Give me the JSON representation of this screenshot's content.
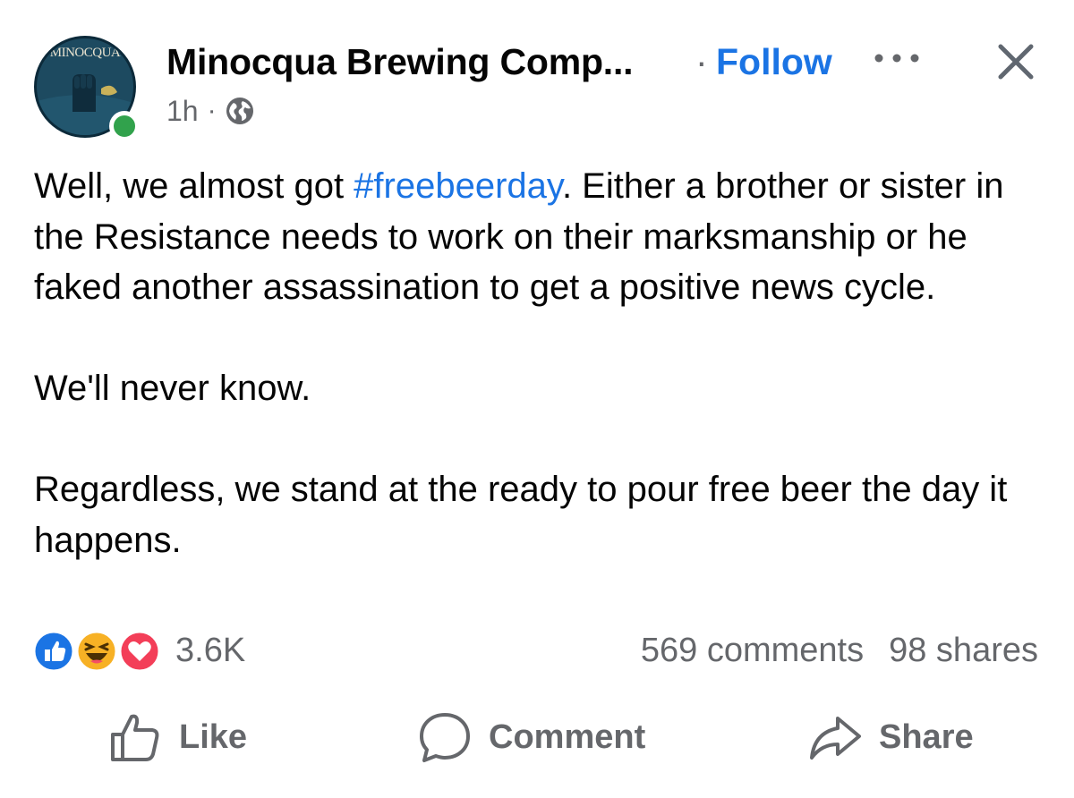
{
  "header": {
    "avatar_text": "MINOCQUA",
    "page_name": "Minocqua Brewing Comp...",
    "separator": "·",
    "follow_label": "Follow",
    "time": "1h",
    "time_separator": "·",
    "audience_icon": "globe-icon",
    "more_icon": "more-horizontal-icon",
    "close_icon": "close-icon"
  },
  "post": {
    "p1_before": "Well, we almost got ",
    "hashtag": "#freebeerday",
    "p1_after": ".  Either a brother or sister in the Resistance needs to work on their marksmanship or he faked another assassination to get a positive news cycle.",
    "p2": "We'll never know.",
    "p3": "Regardless, we stand at the ready to pour free beer the day it happens."
  },
  "stats": {
    "reaction_icons": [
      "like-reaction-icon",
      "haha-reaction-icon",
      "love-reaction-icon"
    ],
    "reaction_count": "3.6K",
    "comments": "569 comments",
    "shares": "98 shares"
  },
  "actions": {
    "like_label": "Like",
    "comment_label": "Comment",
    "share_label": "Share"
  },
  "colors": {
    "accent": "#1b74e4",
    "secondary_text": "#65676b",
    "online": "#31a24c",
    "love": "#f33e58",
    "haha": "#f7b125"
  }
}
